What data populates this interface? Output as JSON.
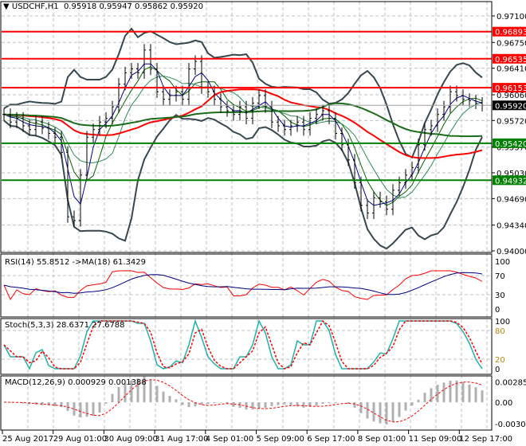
{
  "header": {
    "symbol": "USDCHF,H1",
    "open": "0.95918",
    "high": "0.95947",
    "low": "0.95862",
    "close": "0.95920"
  },
  "price_axis": {
    "ticks": [
      "0.97100",
      "0.96750",
      "0.96410",
      "0.96060",
      "0.95720",
      "0.95370",
      "0.95030",
      "0.94690",
      "0.94340",
      "0.94000"
    ],
    "current": "0.95920"
  },
  "levels": [
    {
      "value": "0.96893",
      "color": "#ff0000"
    },
    {
      "value": "0.96535",
      "color": "#ff0000"
    },
    {
      "value": "0.96153",
      "color": "#ff0000"
    },
    {
      "value": "0.95420",
      "color": "#008000"
    },
    {
      "value": "0.94932",
      "color": "#008000"
    }
  ],
  "rsi": {
    "label": "RSI(14) 55.8512  ->MA(18) 61.3429",
    "ticks": [
      "100",
      "70",
      "30",
      "0"
    ]
  },
  "stoch": {
    "label": "Stoch(5,3,3) 28.6371 27.6788",
    "ticks": [
      "100",
      "80",
      "20",
      "0"
    ]
  },
  "macd": {
    "label": "MACD(12,26,9) 0.000929 0.001388",
    "ticks": [
      "0.002856",
      "0.00",
      "-0.003017"
    ]
  },
  "time_axis": [
    "25 Aug 2017",
    "29 Aug 01:00",
    "30 Aug 09:00",
    "31 Aug 17:00",
    "4 Sep 01:00",
    "5 Sep 09:00",
    "6 Sep 17:00",
    "8 Sep 01:00",
    "11 Sep 09:00",
    "12 Sep 17:00"
  ],
  "chart_data": {
    "type": "line",
    "title": "USDCHF,H1",
    "ylim": [
      0.94,
      0.971
    ],
    "closes": [
      0.958,
      0.957,
      0.9575,
      0.9565,
      0.956,
      0.957,
      0.9562,
      0.9555,
      0.955,
      0.953,
      0.9445,
      0.944,
      0.95,
      0.955,
      0.956,
      0.957,
      0.9575,
      0.959,
      0.962,
      0.9635,
      0.964,
      0.9635,
      0.9665,
      0.964,
      0.961,
      0.96,
      0.9605,
      0.961,
      0.96,
      0.964,
      0.965,
      0.9615,
      0.961,
      0.96,
      0.959,
      0.9585,
      0.958,
      0.959,
      0.9575,
      0.9595,
      0.9605,
      0.959,
      0.957,
      0.9565,
      0.956,
      0.9565,
      0.957,
      0.956,
      0.9575,
      0.958,
      0.9585,
      0.9575,
      0.9555,
      0.954,
      0.952,
      0.949,
      0.946,
      0.945,
      0.947,
      0.9465,
      0.9455,
      0.948,
      0.949,
      0.95,
      0.951,
      0.954,
      0.956,
      0.9565,
      0.958,
      0.959,
      0.961,
      0.9605,
      0.96,
      0.9598,
      0.9595,
      0.9592
    ]
  }
}
